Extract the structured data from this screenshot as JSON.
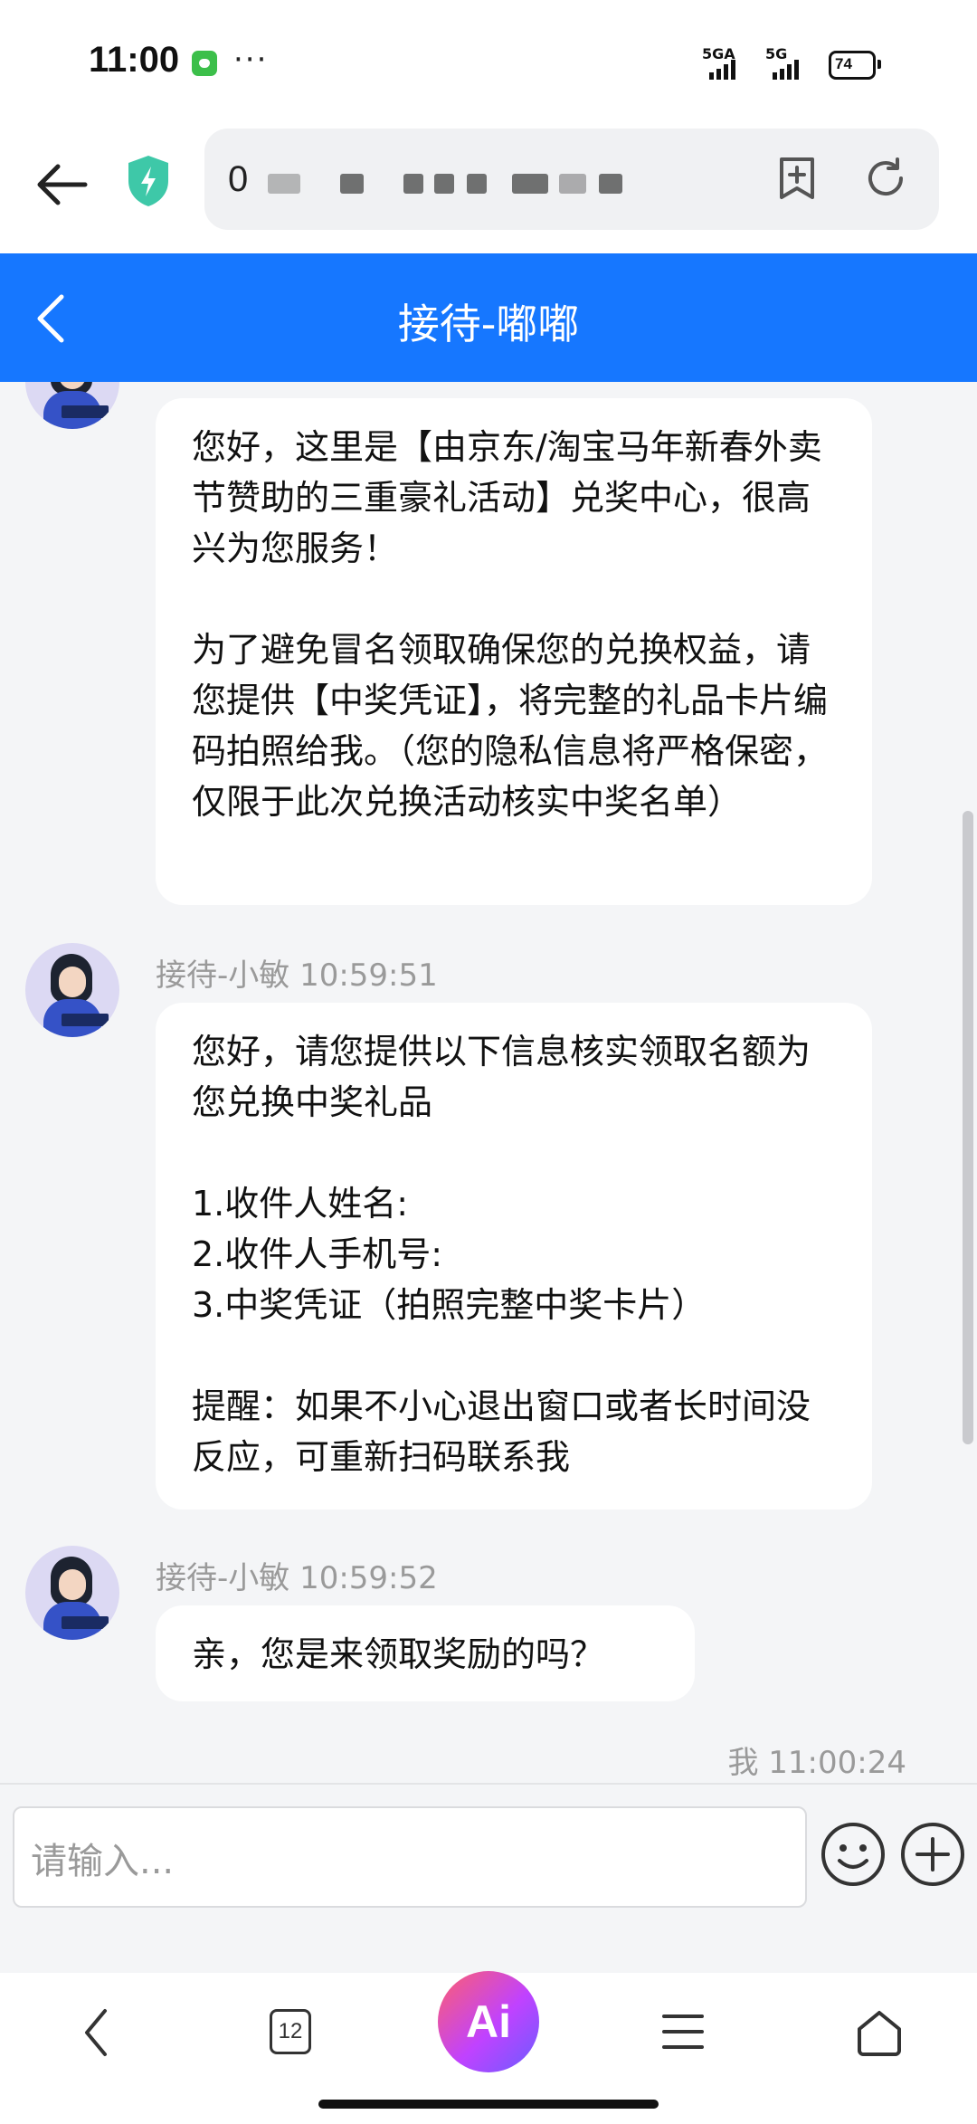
{
  "status_bar": {
    "time": "11:00",
    "dots": "···",
    "signal_1": "5GA",
    "signal_2": "5G",
    "battery": "74"
  },
  "browser": {
    "url_start": "0"
  },
  "chat_header": {
    "title": "接待-嘟嘟"
  },
  "messages": [
    {
      "sender": "",
      "text": "您好，这里是【由京东/淘宝马年新春外卖节赞助的三重豪礼活动】兑奖中心，很高兴为您服务！\n\n为了避免冒名领取确保您的兑换权益，请您提供【中奖凭证】，将完整的礼品卡片编码拍照给我。（您的隐私信息将严格保密，仅限于此次兑换活动核实中奖名单）"
    },
    {
      "sender": "接待-小敏 10:59:51",
      "text": "您好，请您提供以下信息核实领取名额为您兑换中奖礼品\n\n1.收件人姓名:\n2.收件人手机号:\n3.中奖凭证（拍照完整中奖卡片）\n\n提醒：如果不小心退出窗口或者长时间没反应，可重新扫码联系我"
    },
    {
      "sender": "接待-小敏 10:59:52",
      "text": "亲，您是来领取奖励的吗？"
    }
  ],
  "my_meta": "我 11:00:24",
  "input": {
    "placeholder": "请输入..."
  },
  "bottom_nav": {
    "tab_count": "12",
    "ai_label": "Ai"
  }
}
